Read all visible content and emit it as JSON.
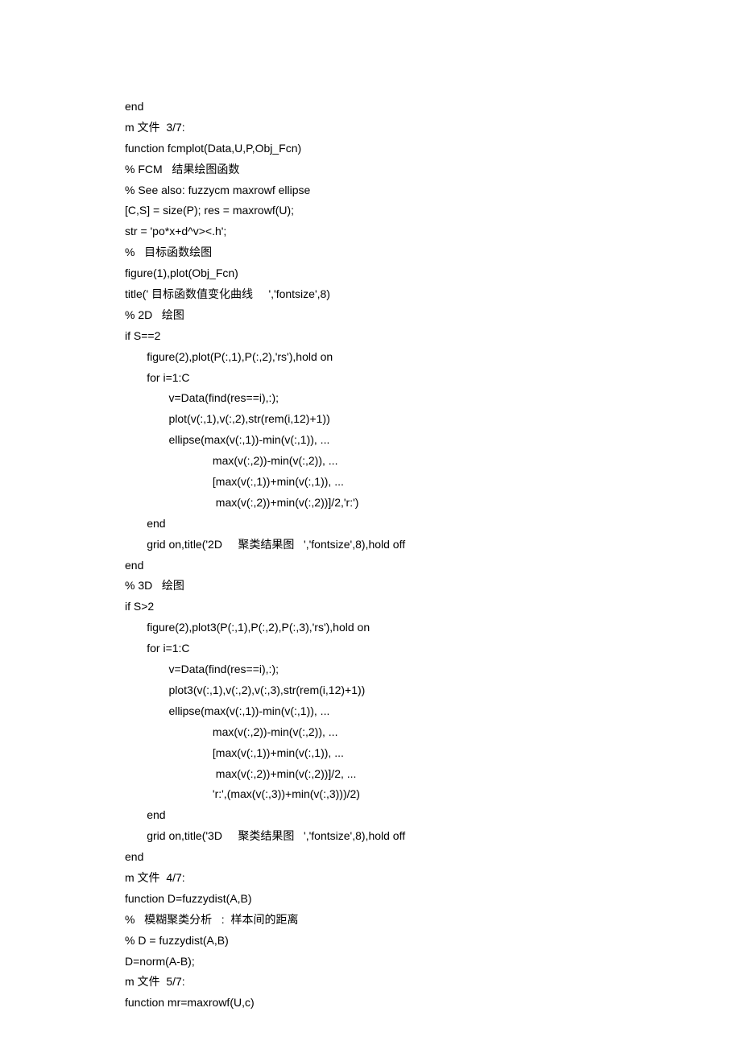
{
  "code": {
    "lines": [
      "end",
      "m 文件  3/7:",
      "function fcmplot(Data,U,P,Obj_Fcn)",
      "% FCM   结果绘图函数",
      "% See also: fuzzycm maxrowf ellipse",
      "[C,S] = size(P); res = maxrowf(U);",
      "str = 'po*x+d^v><.h';",
      "%   目标函数绘图",
      "figure(1),plot(Obj_Fcn)",
      "title(' 目标函数值变化曲线     ','fontsize',8)",
      "% 2D   绘图",
      "if S==2",
      "       figure(2),plot(P(:,1),P(:,2),'rs'),hold on",
      "       for i=1:C",
      "              v=Data(find(res==i),:);",
      "              plot(v(:,1),v(:,2),str(rem(i,12)+1))",
      "              ellipse(max(v(:,1))-min(v(:,1)), ...",
      "                            max(v(:,2))-min(v(:,2)), ...",
      "                            [max(v(:,1))+min(v(:,1)), ...",
      "                             max(v(:,2))+min(v(:,2))]/2,'r:')",
      "       end",
      "       grid on,title('2D     聚类结果图   ','fontsize',8),hold off",
      "end",
      "% 3D   绘图",
      "if S>2",
      "       figure(2),plot3(P(:,1),P(:,2),P(:,3),'rs'),hold on",
      "       for i=1:C",
      "              v=Data(find(res==i),:);",
      "              plot3(v(:,1),v(:,2),v(:,3),str(rem(i,12)+1))",
      "              ellipse(max(v(:,1))-min(v(:,1)), ...",
      "                            max(v(:,2))-min(v(:,2)), ...",
      "                            [max(v(:,1))+min(v(:,1)), ...",
      "                             max(v(:,2))+min(v(:,2))]/2, ...",
      "                            'r:',(max(v(:,3))+min(v(:,3)))/2)",
      "       end",
      "       grid on,title('3D     聚类结果图   ','fontsize',8),hold off",
      "end",
      "m 文件  4/7:",
      "function D=fuzzydist(A,B)",
      "%   模糊聚类分析   :  样本间的距离",
      "% D = fuzzydist(A,B)",
      "D=norm(A-B);",
      "m 文件  5/7:",
      "function mr=maxrowf(U,c)"
    ]
  }
}
